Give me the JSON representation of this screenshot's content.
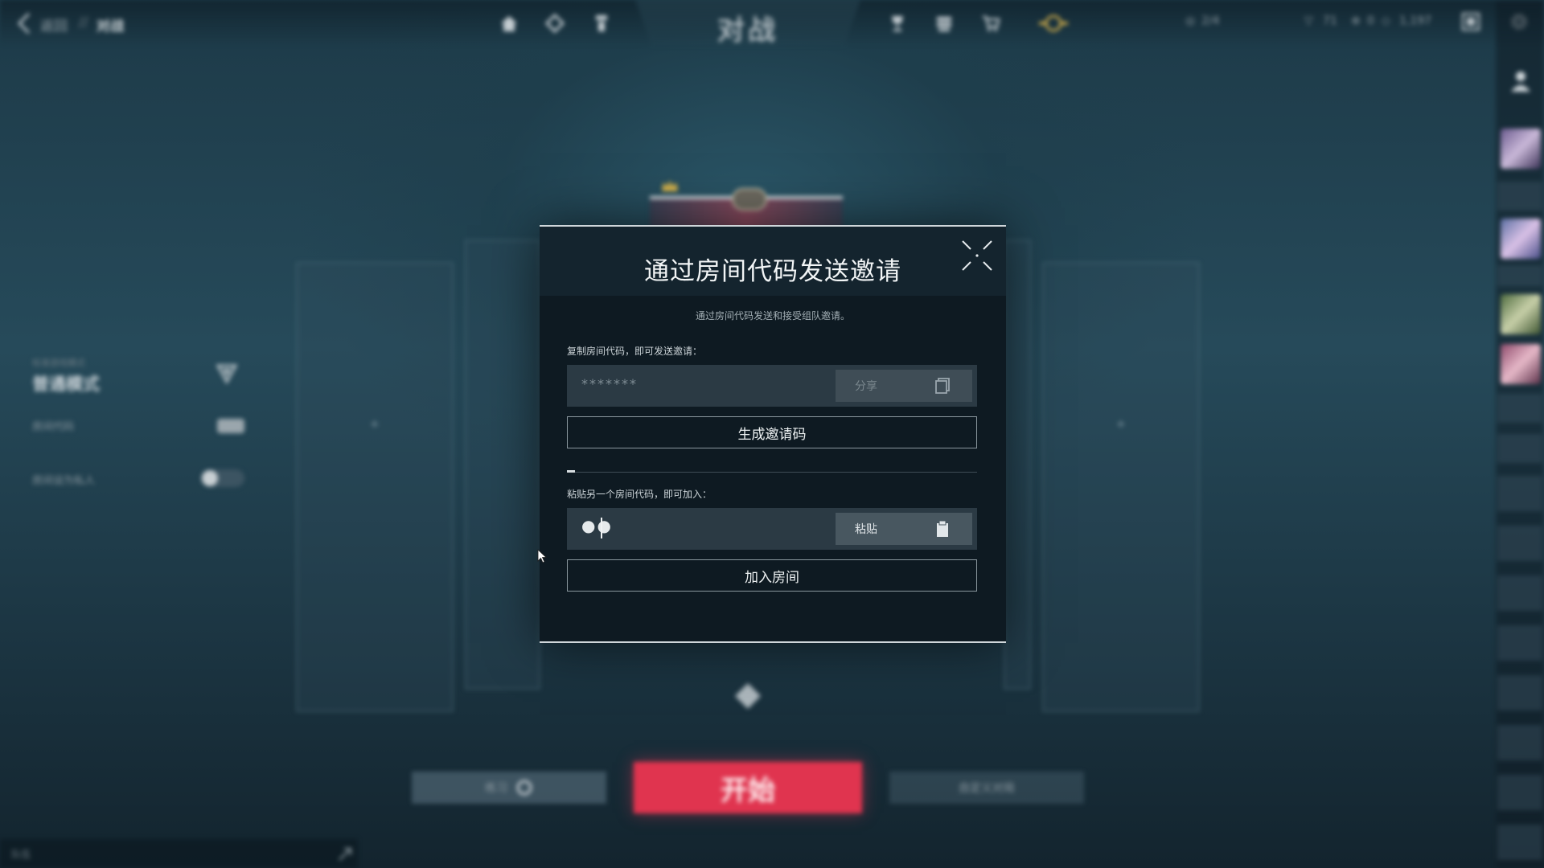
{
  "topbar": {
    "breadcrumb_back": "返回",
    "breadcrumb_sep": "//",
    "breadcrumb_current": "对战",
    "title": "对战",
    "points": "2/4",
    "currencies": [
      "71",
      "0",
      "1,197"
    ],
    "nav_icons": [
      "home-icon",
      "tag-icon",
      "agent-icon",
      "trophy-icon",
      "collection-icon",
      "store-icon",
      "battlepass-icon"
    ]
  },
  "left_panel": {
    "mode_caption": "标准游戏模式",
    "mode_name": "普通模式",
    "row1_label": "房间代码",
    "row2_label": "房间设为私人"
  },
  "bottom": {
    "practice_label": "练习",
    "start_label": "开始",
    "queue_label": "自定义对局",
    "chat_placeholder": "队伍"
  },
  "modal": {
    "title": "通过房间代码发送邀请",
    "subtitle": "通过房间代码发送和接受组队邀请。",
    "copy_label": "复制房间代码，即可发送邀请：",
    "code_masked": "*******",
    "share_label": "分享",
    "generate_label": "生成邀请码",
    "paste_label": "粘贴另一个房间代码，即可加入：",
    "paste_value": "●●",
    "paste_button": "粘贴",
    "join_label": "加入房间"
  },
  "colors": {
    "start_button": "#e0344f",
    "modal_bg": "#0e1a22",
    "modal_header": "#14242e",
    "field_bg": "#2b3a44"
  }
}
